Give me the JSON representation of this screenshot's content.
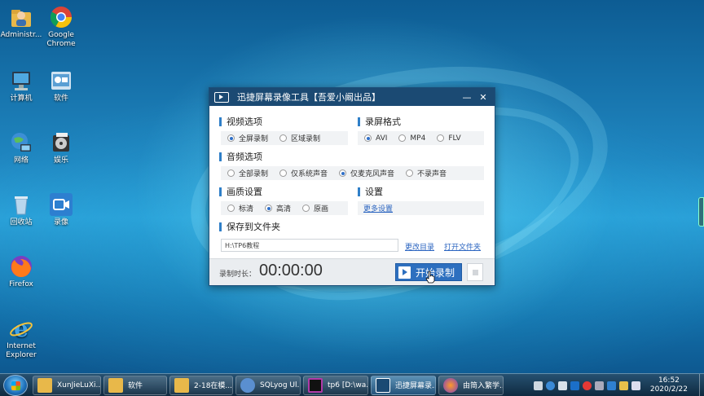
{
  "desktop": {
    "icons": [
      {
        "label": "Administr...",
        "icon": "user-folder-icon"
      },
      {
        "label": "Google Chrome",
        "icon": "chrome-icon"
      },
      {
        "label": "计算机",
        "icon": "computer-icon"
      },
      {
        "label": "软件",
        "icon": "software-icon"
      },
      {
        "label": "网络",
        "icon": "network-icon"
      },
      {
        "label": "娱乐",
        "icon": "dvd-icon"
      },
      {
        "label": "回收站",
        "icon": "recycle-bin-icon"
      },
      {
        "label": "录像",
        "icon": "video-recorder-icon"
      },
      {
        "label": "Firefox",
        "icon": "firefox-icon"
      },
      {
        "label": "Internet Explorer",
        "icon": "ie-icon"
      }
    ]
  },
  "window": {
    "title": "迅捷屏幕录像工具【吾爱小阚出品】",
    "video": {
      "heading": "视频选项",
      "options": [
        {
          "label": "全屏录制",
          "selected": true
        },
        {
          "label": "区域录制",
          "selected": false
        }
      ]
    },
    "format": {
      "heading": "录屏格式",
      "options": [
        {
          "label": "AVI",
          "selected": true
        },
        {
          "label": "MP4",
          "selected": false
        },
        {
          "label": "FLV",
          "selected": false
        }
      ]
    },
    "audio": {
      "heading": "音频选项",
      "options": [
        {
          "label": "全部录制",
          "selected": false
        },
        {
          "label": "仅系统声音",
          "selected": false
        },
        {
          "label": "仅麦克风声音",
          "selected": true
        },
        {
          "label": "不录声音",
          "selected": false
        }
      ]
    },
    "quality": {
      "heading": "画质设置",
      "options": [
        {
          "label": "标清",
          "selected": false
        },
        {
          "label": "高清",
          "selected": true
        },
        {
          "label": "原画",
          "selected": false
        }
      ]
    },
    "settings": {
      "heading": "设置",
      "more_link": "更多设置"
    },
    "save": {
      "heading": "保存到文件夹",
      "path": "H:\\TP6教程",
      "change_link": "更改目录",
      "open_link": "打开文件夹"
    },
    "footer": {
      "duration_label": "录制时长：",
      "duration": "00:00:00",
      "record_label": "开始录制"
    }
  },
  "taskbar": {
    "items": [
      {
        "label": "XunJieLuXi...",
        "icon": "folder-icon",
        "color": "#e8b84a",
        "active": false
      },
      {
        "label": "软件",
        "icon": "folder-icon",
        "color": "#e8b84a",
        "active": false
      },
      {
        "label": "2-18在模...",
        "icon": "folder-icon",
        "color": "#e8b84a",
        "active": false
      },
      {
        "label": "SQLyog Ul...",
        "icon": "sqlyog-icon",
        "color": "#5a8fd0",
        "active": false
      },
      {
        "label": "tp6 [D:\\wa...",
        "icon": "phpstorm-icon",
        "color": "#b03aa8",
        "active": false
      },
      {
        "label": "迅捷屏幕录...",
        "icon": "video-recorder-icon",
        "color": "#1b4a73",
        "active": true
      },
      {
        "label": "由简入繁学...",
        "icon": "firefox-icon",
        "color": "#e8652a",
        "active": false
      }
    ],
    "clock_time": "16:52",
    "clock_date": "2020/2/22"
  }
}
